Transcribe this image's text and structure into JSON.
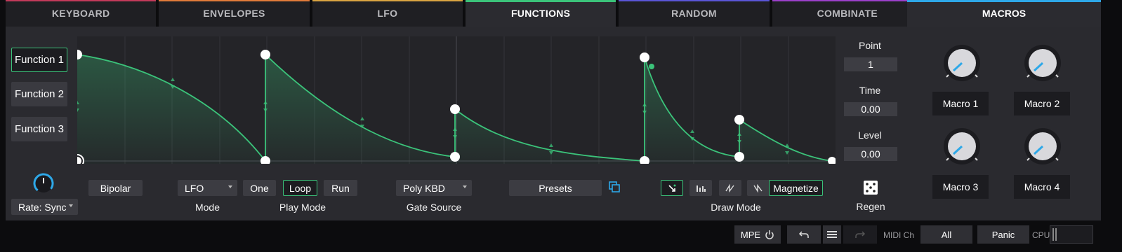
{
  "tabs": [
    {
      "label": "KEYBOARD",
      "color": "#c23a5a"
    },
    {
      "label": "ENVELOPES",
      "color": "#e07a3a"
    },
    {
      "label": "LFO",
      "color": "#d9a441"
    },
    {
      "label": "FUNCTIONS",
      "color": "#3bc37a",
      "active": true
    },
    {
      "label": "RANDOM",
      "color": "#5a55d6"
    },
    {
      "label": "COMBINATE",
      "color": "#9b3fc9"
    }
  ],
  "macros_tab": "MACROS",
  "functions": [
    "Function 1",
    "Function 2",
    "Function 3"
  ],
  "rate": "Rate: Sync",
  "controls": {
    "bipolar": "Bipolar",
    "mode_value": "LFO",
    "mode_label": "Mode",
    "play_one": "One",
    "play_loop": "Loop",
    "play_run": "Run",
    "play_label": "Play Mode",
    "gate_value": "Poly KBD",
    "gate_label": "Gate Source",
    "presets": "Presets",
    "magnetize": "Magnetize",
    "draw_label": "Draw Mode"
  },
  "point": {
    "label": "Point",
    "value": "1"
  },
  "time": {
    "label": "Time",
    "value": "0.00"
  },
  "level": {
    "label": "Level",
    "value": "0.00"
  },
  "regen": "Regen",
  "macros": [
    "Macro 1",
    "Macro 2",
    "Macro 3",
    "Macro 4"
  ],
  "footer": {
    "mpe": "MPE",
    "midi_ch_label": "MIDI Ch",
    "midi_ch_value": "All",
    "panic": "Panic",
    "cpu_label": "CPU"
  },
  "accent": "#3bc37a",
  "knob_accent": "#2ea8e8"
}
